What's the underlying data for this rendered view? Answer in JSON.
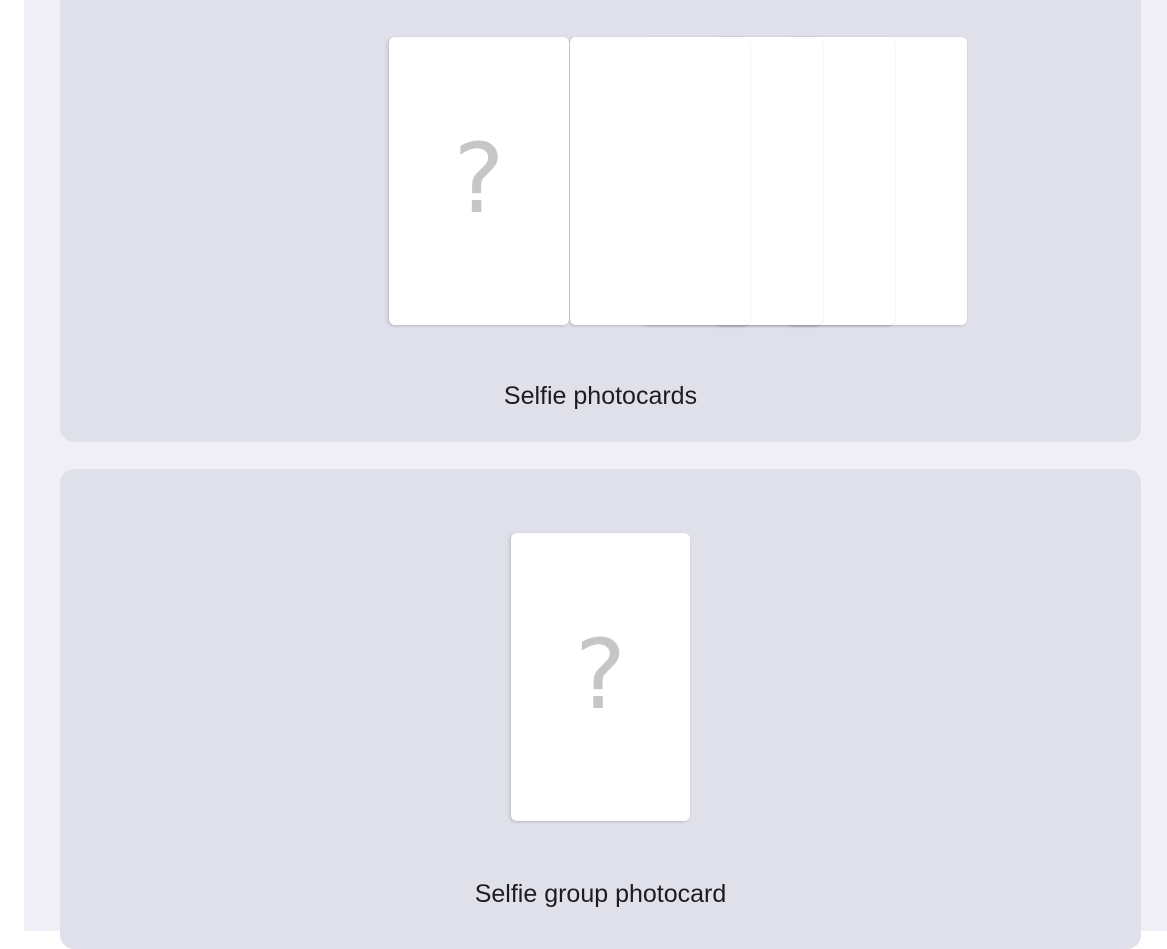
{
  "sections": [
    {
      "label": "Selfie photocards",
      "placeholder_glyph": "?"
    },
    {
      "label": "Selfie group photocard",
      "placeholder_glyph": "?"
    }
  ],
  "colors": {
    "page_background": "#efeff5",
    "panel_background": "#dfe0ea",
    "card_background": "#ffffff",
    "placeholder_glyph": "#c6c6c6",
    "label_text": "#1c1c1f"
  },
  "icons": {
    "placeholder": "question-mark-icon"
  }
}
